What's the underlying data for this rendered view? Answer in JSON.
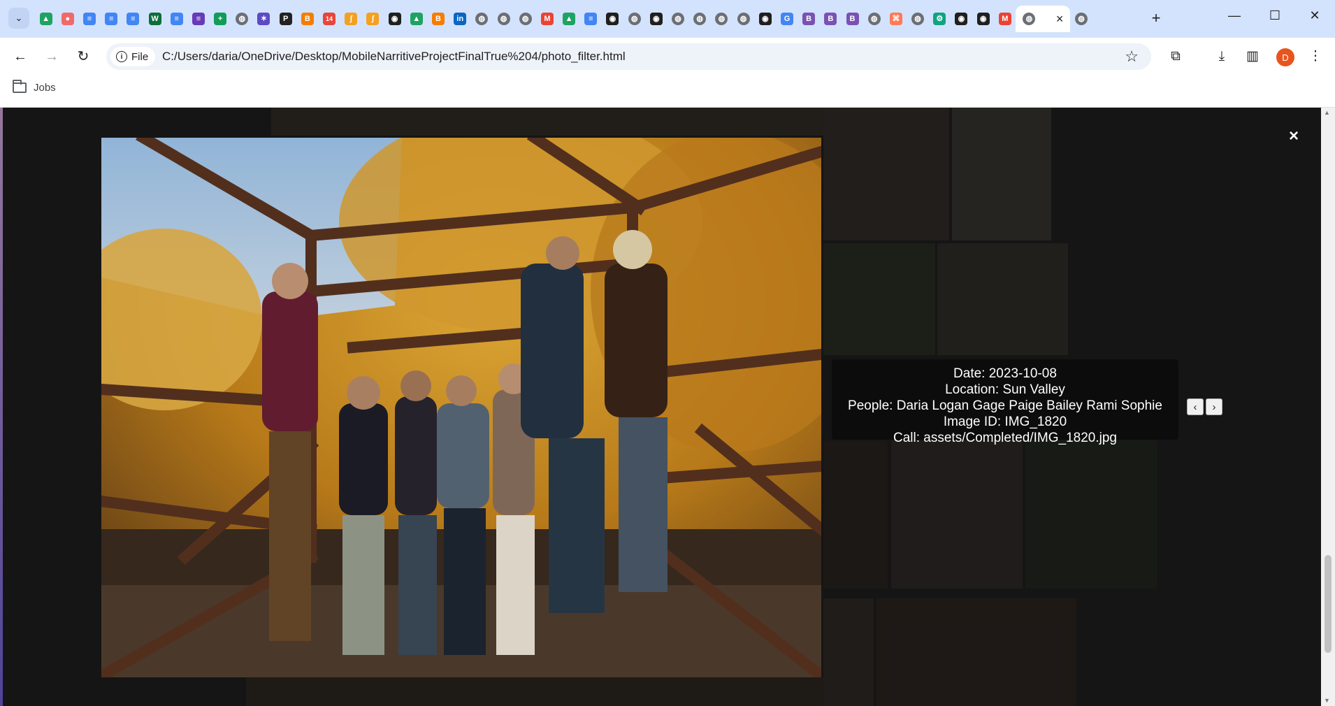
{
  "browser": {
    "tab_icons": [
      "drive-icon",
      "asana-icon",
      "docs-icon",
      "docs-icon",
      "docs-icon",
      "wix-icon",
      "docs-icon",
      "forms-icon",
      "sheets-icon",
      "globe-icon",
      "perplexity-icon",
      "pocketcasts-icon",
      "blogger-icon",
      "calendar-icon",
      "duolingo-icon",
      "duolingo-icon",
      "github-icon",
      "drive-icon",
      "blogger-icon",
      "linkedin-icon",
      "globe-icon",
      "globe-icon",
      "globe-icon",
      "gmail-icon",
      "drive-icon",
      "docs-icon",
      "github-icon",
      "globe-icon",
      "github-icon",
      "globe-icon",
      "globe-icon",
      "globe-icon",
      "globe-icon",
      "github-icon",
      "google-icon",
      "bootstrap-icon",
      "bootstrap-icon",
      "bootstrap-icon",
      "globe-icon",
      "hubspot-icon",
      "globe-icon",
      "chatgpt-icon",
      "github-icon",
      "github-icon",
      "gmail-icon"
    ],
    "calendar_badge": "14",
    "url_scheme": "File",
    "url": "C:/Users/daria/OneDrive/Desktop/MobileNarritiveProjectFinalTrue%204/photo_filter.html",
    "profile_initial": "D",
    "bookmarks": [
      {
        "label": "Jobs"
      }
    ]
  },
  "viewer": {
    "close_label": "×",
    "caption": {
      "date": "Date: 2023-10-08",
      "location": "Location: Sun Valley",
      "people": "People: Daria Logan Gage Paige Bailey Rami Sophie",
      "image_id": "Image ID: IMG_1820",
      "call": "Call: assets/Completed/IMG_1820.jpg"
    },
    "prev_label": "‹",
    "next_label": "›"
  },
  "colors": {
    "tabstrip": "#d3e3fd",
    "overlay_bg": "#1c1c1c",
    "caption_bg": "#0a0a0a",
    "profile": "#e8541e"
  }
}
